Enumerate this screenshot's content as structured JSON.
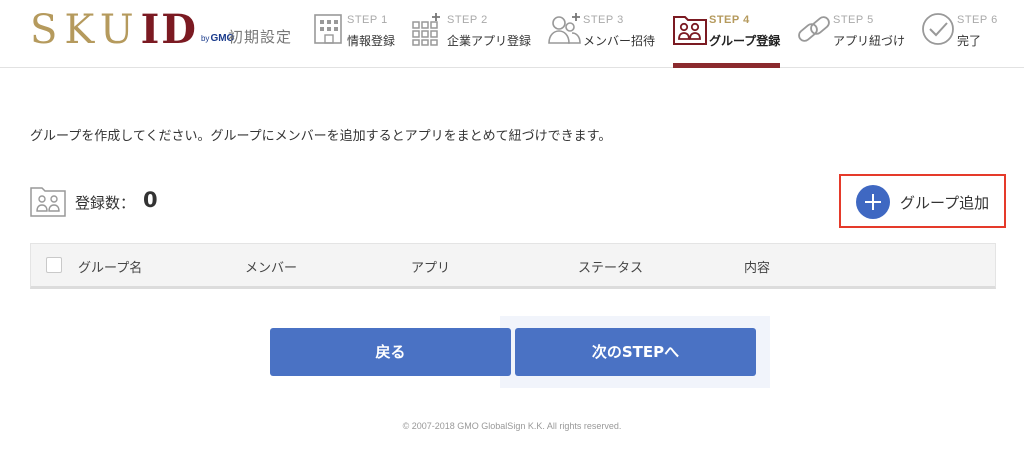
{
  "header": {
    "logo": {
      "sku": "SKU",
      "id": "ID",
      "by": "by",
      "gmo": "GMO"
    },
    "init_label": "初期設定",
    "steps": [
      {
        "num": "STEP 1",
        "label": "情報登録",
        "icon": "building-icon"
      },
      {
        "num": "STEP 2",
        "label": "企業アプリ登録",
        "icon": "app-grid-plus-icon"
      },
      {
        "num": "STEP 3",
        "label": "メンバー招待",
        "icon": "users-plus-icon"
      },
      {
        "num": "STEP 4",
        "label": "グループ登録",
        "icon": "group-folder-icon",
        "active": true
      },
      {
        "num": "STEP 5",
        "label": "アプリ紐づけ",
        "icon": "link-icon"
      },
      {
        "num": "STEP 6",
        "label": "完了",
        "icon": "check-circle-icon"
      }
    ]
  },
  "main": {
    "description": "グループを作成してください。グループにメンバーを追加するとアプリをまとめて紐づけできます。",
    "count_label": "登録数：",
    "count_value": "0",
    "add_group_label": "グループ追加",
    "table": {
      "columns": [
        "グループ名",
        "メンバー",
        "アプリ",
        "ステータス",
        "内容"
      ]
    },
    "back_label": "戻る",
    "next_label": "次のSTEPへ"
  },
  "footer": {
    "copyright": "© 2007-2018 GMO GlobalSign K.K. All rights reserved."
  },
  "colors": {
    "brand_gold": "#b59a5d",
    "brand_maroon": "#7b1a22",
    "primary_blue": "#4a72c4",
    "highlight_red": "#e53a2a",
    "active_bar": "#8b2a2e"
  }
}
